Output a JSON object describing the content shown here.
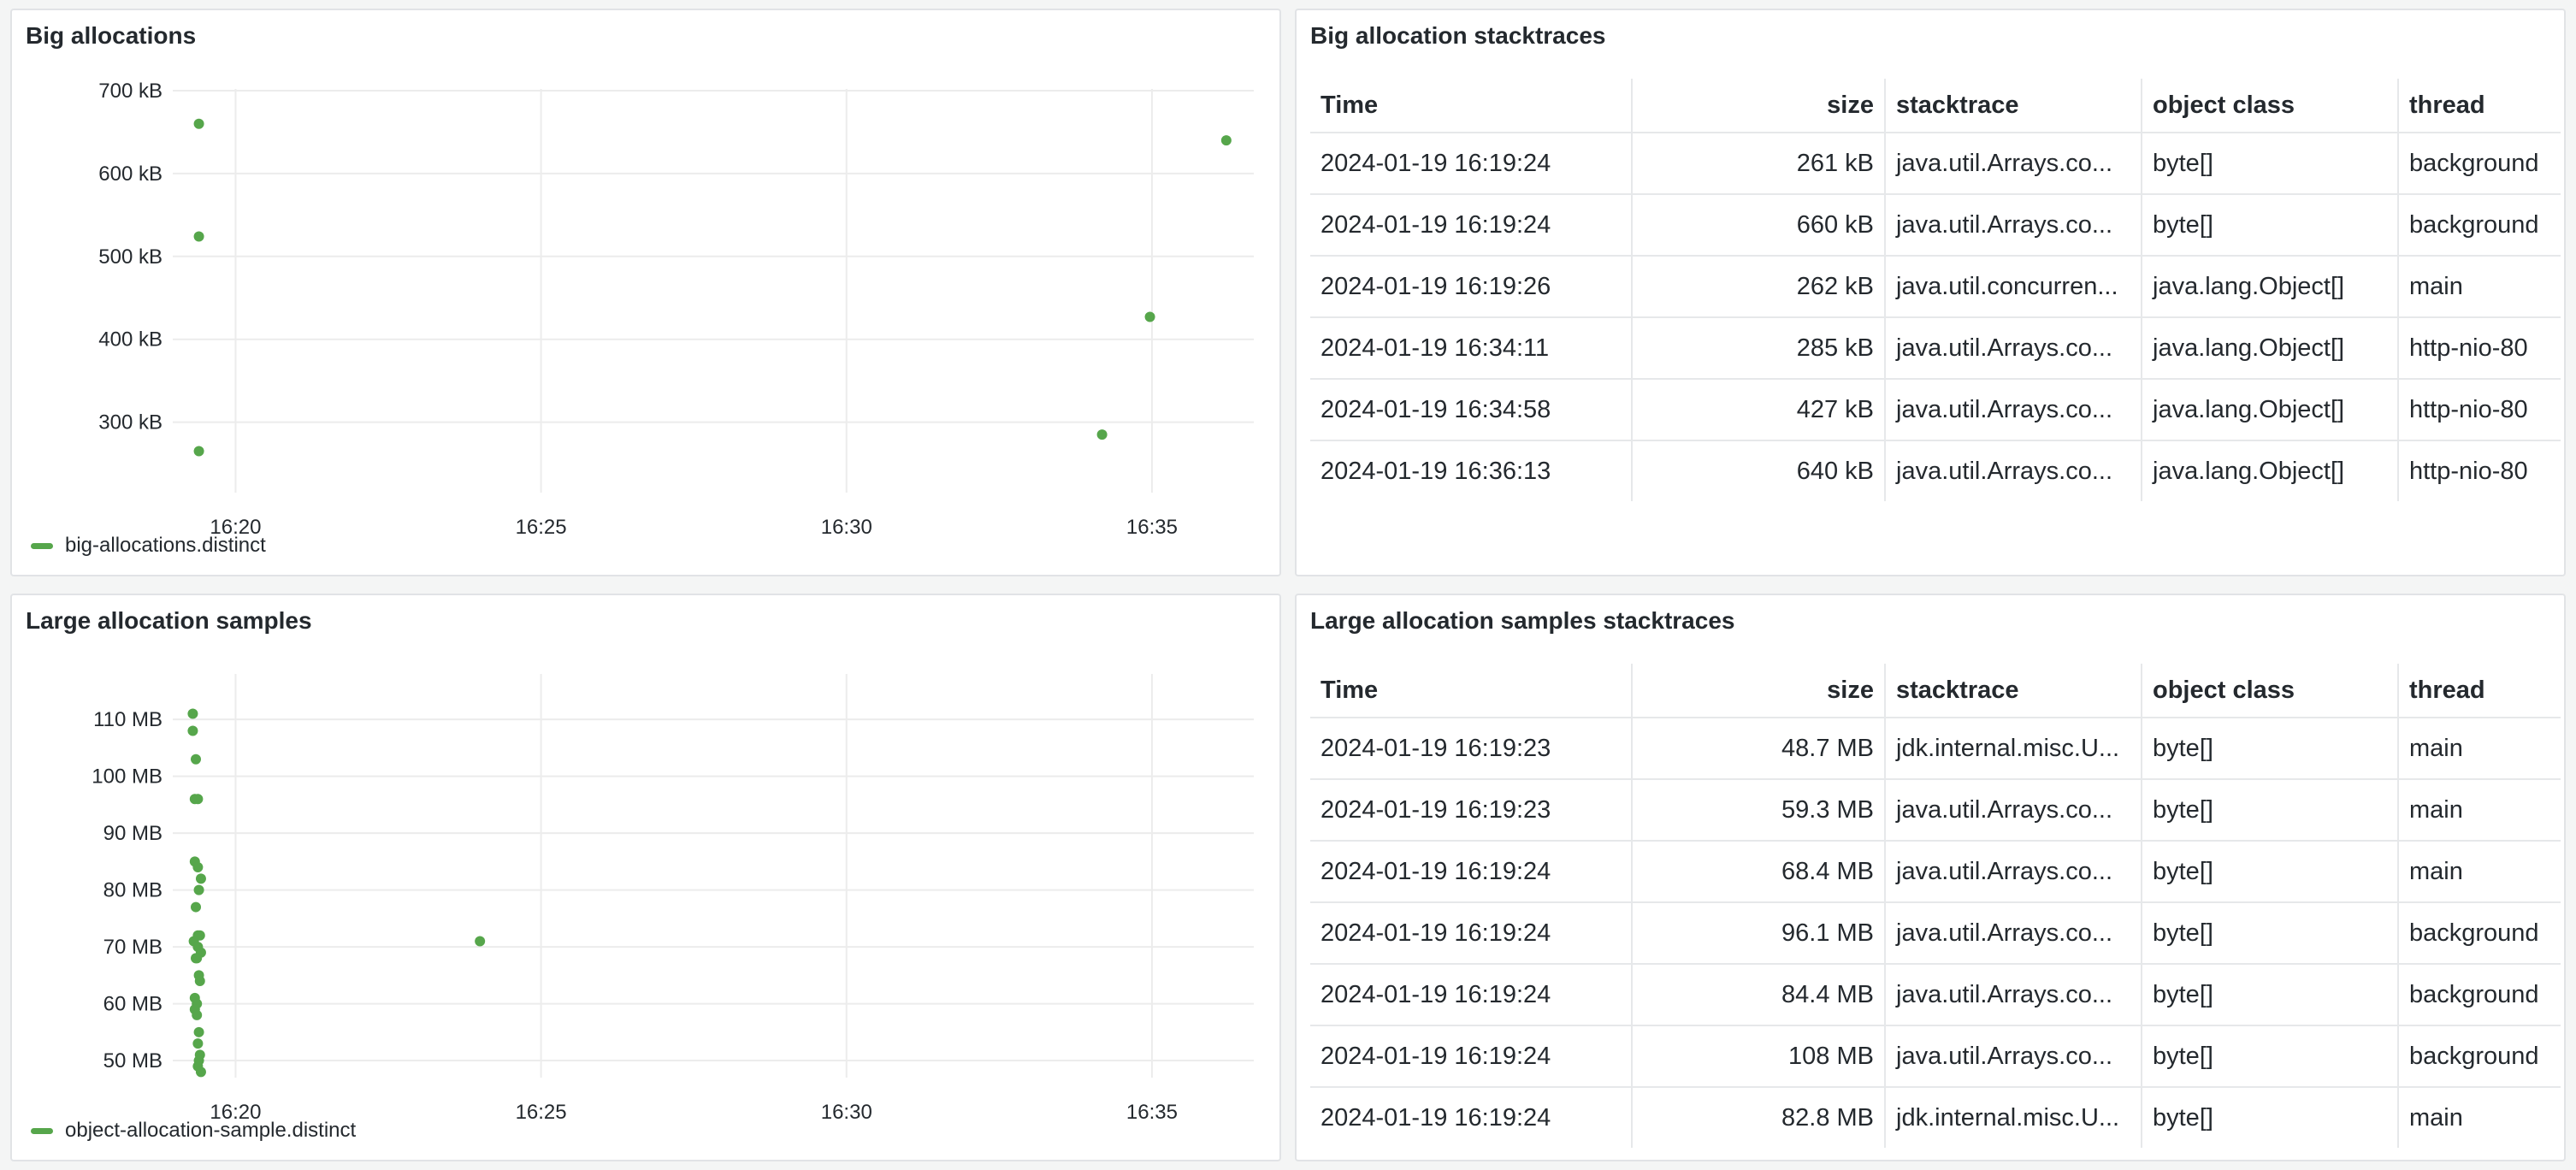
{
  "theme": {
    "accent": "#56a64b",
    "grid": "#ececec",
    "border": "#e1e3e6"
  },
  "panels": {
    "big_allocations": {
      "title": "Big allocations",
      "legend": "big-allocations.distinct"
    },
    "big_allocation_stacktraces": {
      "title": "Big allocation stacktraces",
      "columns": [
        "Time",
        "size",
        "stacktrace",
        "object class",
        "thread"
      ],
      "rows": [
        [
          "2024-01-19 16:19:24",
          "261 kB",
          "java.util.Arrays.co...",
          "byte[]",
          "background"
        ],
        [
          "2024-01-19 16:19:24",
          "660 kB",
          "java.util.Arrays.co...",
          "byte[]",
          "background"
        ],
        [
          "2024-01-19 16:19:26",
          "262 kB",
          "java.util.concurren...",
          "java.lang.Object[]",
          "main"
        ],
        [
          "2024-01-19 16:34:11",
          "285 kB",
          "java.util.Arrays.co...",
          "java.lang.Object[]",
          "http-nio-80"
        ],
        [
          "2024-01-19 16:34:58",
          "427 kB",
          "java.util.Arrays.co...",
          "java.lang.Object[]",
          "http-nio-80"
        ],
        [
          "2024-01-19 16:36:13",
          "640 kB",
          "java.util.Arrays.co...",
          "java.lang.Object[]",
          "http-nio-80"
        ]
      ]
    },
    "large_allocation_samples": {
      "title": "Large allocation samples",
      "legend": "object-allocation-sample.distinct"
    },
    "large_allocation_samples_stacktraces": {
      "title": "Large allocation samples stacktraces",
      "columns": [
        "Time",
        "size",
        "stacktrace",
        "object class",
        "thread"
      ],
      "rows": [
        [
          "2024-01-19 16:19:23",
          "48.7 MB",
          "jdk.internal.misc.U...",
          "byte[]",
          "main"
        ],
        [
          "2024-01-19 16:19:23",
          "59.3 MB",
          "java.util.Arrays.co...",
          "byte[]",
          "main"
        ],
        [
          "2024-01-19 16:19:24",
          "68.4 MB",
          "java.util.Arrays.co...",
          "byte[]",
          "main"
        ],
        [
          "2024-01-19 16:19:24",
          "96.1 MB",
          "java.util.Arrays.co...",
          "byte[]",
          "background"
        ],
        [
          "2024-01-19 16:19:24",
          "84.4 MB",
          "java.util.Arrays.co...",
          "byte[]",
          "background"
        ],
        [
          "2024-01-19 16:19:24",
          "108 MB",
          "java.util.Arrays.co...",
          "byte[]",
          "background"
        ],
        [
          "2024-01-19 16:19:24",
          "82.8 MB",
          "jdk.internal.misc.U...",
          "byte[]",
          "main"
        ]
      ]
    }
  },
  "chart_data": [
    {
      "type": "scatter",
      "title": "Big allocations",
      "series": [
        {
          "name": "big-allocations.distinct",
          "color": "#56a64b",
          "x": [
            "16:19:24",
            "16:19:24",
            "16:19:24",
            "16:34:11",
            "16:34:58",
            "16:36:13"
          ],
          "y": [
            660,
            524,
            265,
            285,
            427,
            640
          ]
        }
      ],
      "x_ticks": [
        "16:20",
        "16:25",
        "16:30",
        "16:35"
      ],
      "y_ticks": [
        "300 kB",
        "400 kB",
        "500 kB",
        "600 kB",
        "700 kB"
      ],
      "y_tick_values": [
        300,
        400,
        500,
        600,
        700
      ],
      "xlim": [
        "16:19:00",
        "16:36:40"
      ],
      "ylim": [
        215,
        702
      ],
      "y_unit": "kB",
      "grid": true,
      "legend": "bottom-left"
    },
    {
      "type": "scatter",
      "title": "Large allocation samples",
      "series": [
        {
          "name": "object-allocation-sample.distinct",
          "color": "#56a64b",
          "x": [
            "16:19:18",
            "16:19:18",
            "16:19:21",
            "16:19:20",
            "16:19:23",
            "16:19:20",
            "16:19:23",
            "16:19:26",
            "16:19:24",
            "16:19:21",
            "16:19:23",
            "16:19:19",
            "16:19:25",
            "16:19:23",
            "16:19:26",
            "16:19:22",
            "16:19:21",
            "16:19:24",
            "16:19:25",
            "16:19:20",
            "16:19:22",
            "16:19:20",
            "16:19:22",
            "16:19:24",
            "16:19:23",
            "16:19:25",
            "16:19:24",
            "16:19:23",
            "16:19:26",
            "16:24:00"
          ],
          "y": [
            111,
            108,
            103,
            96,
            96,
            85,
            84,
            82,
            80,
            77,
            72,
            71,
            72,
            70,
            69,
            68,
            68,
            65,
            64,
            61,
            60,
            59,
            58,
            55,
            53,
            51,
            50,
            49,
            48,
            71
          ],
          "note": "values in MB"
        }
      ],
      "x_ticks": [
        "16:20",
        "16:25",
        "16:30",
        "16:35"
      ],
      "y_ticks": [
        "50 MB",
        "60 MB",
        "70 MB",
        "80 MB",
        "90 MB",
        "100 MB",
        "110 MB"
      ],
      "y_tick_values": [
        50,
        60,
        70,
        80,
        90,
        100,
        110
      ],
      "xlim": [
        "16:19:00",
        "16:36:40"
      ],
      "ylim": [
        47,
        118
      ],
      "y_unit": "MB",
      "grid": true,
      "legend": "bottom-left"
    }
  ]
}
